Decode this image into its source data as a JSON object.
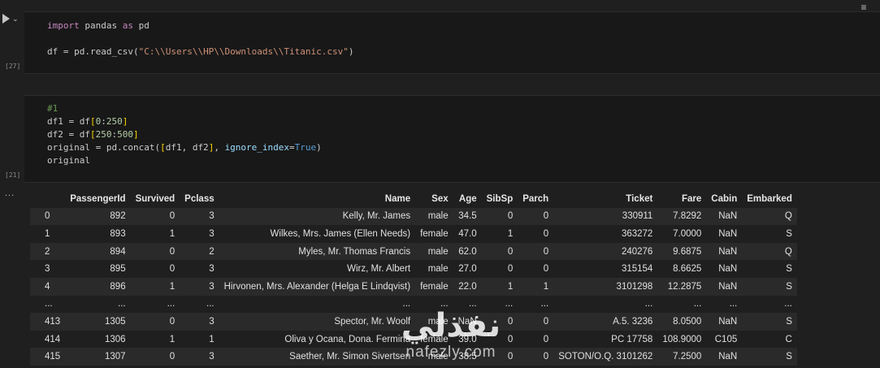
{
  "toolbar": {
    "run_icon": "play-icon",
    "more_icon": "chevron-down-icon",
    "outline_icon": "outline-icon"
  },
  "cells": [
    {
      "exec_count": "[27]",
      "lines": [
        "import pandas as pd",
        "",
        "df = pd.read_csv(\"C:\\\\Users\\\\HP\\\\Downloads\\\\Titanic.csv\")"
      ]
    },
    {
      "exec_count": "[21]",
      "lines": [
        "#1",
        "df1 = df[0:250]",
        "df2 = df[250:500]",
        "original = pd.concat([df1, df2], ignore_index=True)",
        "original"
      ]
    }
  ],
  "output": {
    "ellipsis": "...",
    "columns": [
      "",
      "PassengerId",
      "Survived",
      "Pclass",
      "Name",
      "Sex",
      "Age",
      "SibSp",
      "Parch",
      "Ticket",
      "Fare",
      "Cabin",
      "Embarked"
    ],
    "rows": [
      [
        "0",
        "892",
        "0",
        "3",
        "Kelly, Mr. James",
        "male",
        "34.5",
        "0",
        "0",
        "330911",
        "7.8292",
        "NaN",
        "Q"
      ],
      [
        "1",
        "893",
        "1",
        "3",
        "Wilkes, Mrs. James (Ellen Needs)",
        "female",
        "47.0",
        "1",
        "0",
        "363272",
        "7.0000",
        "NaN",
        "S"
      ],
      [
        "2",
        "894",
        "0",
        "2",
        "Myles, Mr. Thomas Francis",
        "male",
        "62.0",
        "0",
        "0",
        "240276",
        "9.6875",
        "NaN",
        "Q"
      ],
      [
        "3",
        "895",
        "0",
        "3",
        "Wirz, Mr. Albert",
        "male",
        "27.0",
        "0",
        "0",
        "315154",
        "8.6625",
        "NaN",
        "S"
      ],
      [
        "4",
        "896",
        "1",
        "3",
        "Hirvonen, Mrs. Alexander (Helga E Lindqvist)",
        "female",
        "22.0",
        "1",
        "1",
        "3101298",
        "12.2875",
        "NaN",
        "S"
      ],
      [
        "...",
        "...",
        "...",
        "...",
        "...",
        "...",
        "...",
        "...",
        "...",
        "...",
        "...",
        "...",
        "..."
      ],
      [
        "413",
        "1305",
        "0",
        "3",
        "Spector, Mr. Woolf",
        "male",
        "NaN",
        "0",
        "0",
        "A.5. 3236",
        "8.0500",
        "NaN",
        "S"
      ],
      [
        "414",
        "1306",
        "1",
        "1",
        "Oliva y Ocana, Dona. Fermina",
        "female",
        "39.0",
        "0",
        "0",
        "PC 17758",
        "108.9000",
        "C105",
        "C"
      ],
      [
        "415",
        "1307",
        "0",
        "3",
        "Saether, Mr. Simon Sivertsen",
        "male",
        "38.5",
        "0",
        "0",
        "SOTON/O.Q. 3101262",
        "7.2500",
        "NaN",
        "S"
      ]
    ]
  },
  "watermark": {
    "arabic": "نفذلي",
    "latin": "nafezly.com"
  },
  "colors": {
    "background": "#1f1f1f",
    "cell_background": "#181818",
    "keyword": "#c586c0",
    "string": "#ce9178",
    "number": "#b5cea8",
    "comment": "#6a9955"
  }
}
